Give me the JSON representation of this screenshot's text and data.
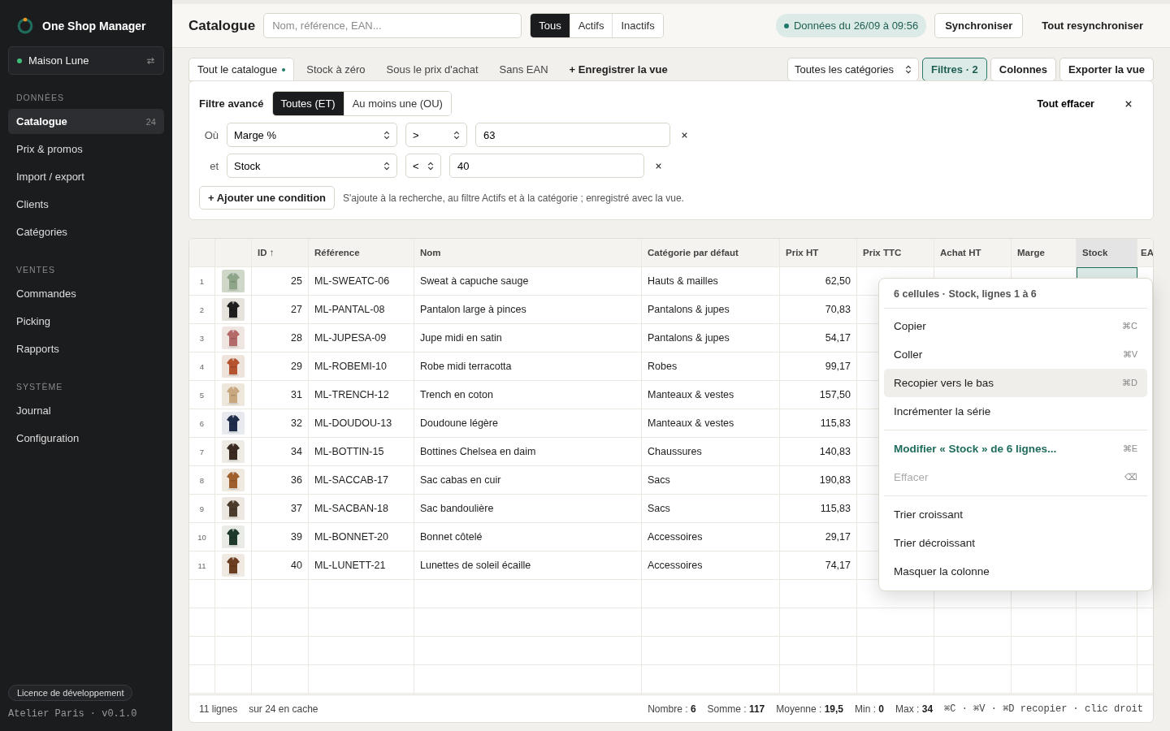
{
  "app": {
    "name": "One Shop Manager"
  },
  "store": {
    "name": "Maison Lune"
  },
  "sidebar": {
    "sections": [
      {
        "title": "DONNÉES",
        "items": [
          {
            "label": "Catalogue",
            "count": "24",
            "selected": true
          },
          {
            "label": "Prix & promos",
            "selected": false
          },
          {
            "label": "Import / export",
            "selected": false
          },
          {
            "label": "Clients",
            "selected": false
          },
          {
            "label": "Catégories",
            "selected": false
          }
        ]
      },
      {
        "title": "VENTES",
        "items": [
          {
            "label": "Commandes",
            "selected": false
          },
          {
            "label": "Picking",
            "selected": false
          },
          {
            "label": "Rapports",
            "selected": false
          }
        ]
      },
      {
        "title": "SYSTÈME",
        "items": [
          {
            "label": "Journal",
            "selected": false
          },
          {
            "label": "Configuration",
            "selected": false
          }
        ]
      }
    ],
    "license": "Licence de développement",
    "version": "Atelier Paris · v0.1.0"
  },
  "header": {
    "title": "Catalogue",
    "search": {
      "placeholder": "Nom, référence, EAN..."
    },
    "status_filter": [
      {
        "label": "Tous",
        "selected": true
      },
      {
        "label": "Actifs",
        "selected": false
      },
      {
        "label": "Inactifs",
        "selected": false
      }
    ],
    "sync_status": "Données du 26/09 à 09:56",
    "buttons": [
      {
        "label": "Synchroniser",
        "kind": "outline"
      },
      {
        "label": "Tout resynchroniser",
        "kind": "plain"
      }
    ]
  },
  "views": {
    "tabs": [
      {
        "label": "Tout le catalogue",
        "selected": true,
        "modified": true
      },
      {
        "label": "Stock à zéro",
        "selected": false,
        "modified": false
      },
      {
        "label": "Sous le prix d'achat",
        "selected": false,
        "modified": false
      },
      {
        "label": "Sans EAN",
        "selected": false,
        "modified": false
      }
    ],
    "save_view": "+ Enregistrer la vue",
    "category_select": "Toutes les catégories",
    "buttons": [
      {
        "label": "Filtres · 2",
        "active": true
      },
      {
        "label": "Colonnes",
        "active": false
      },
      {
        "label": "Exporter la vue",
        "active": false
      }
    ]
  },
  "filter": {
    "title": "Filtre avancé",
    "modes": [
      {
        "label": "Toutes (ET)",
        "selected": true
      },
      {
        "label": "Au moins une (OU)",
        "selected": false
      }
    ],
    "clear": "Tout effacer",
    "conditions": [
      {
        "connector": "Où",
        "field": "Marge %",
        "operator": ">",
        "value": "63"
      },
      {
        "connector": "et",
        "field": "Stock",
        "operator": "<",
        "value": "40"
      }
    ],
    "add": "+ Ajouter une condition",
    "hint": "S'ajoute à la recherche, au filtre Actifs et à la catégorie ; enregistré avec la vue."
  },
  "table": {
    "columns": [
      {
        "label": "ID ↑",
        "kind": "number",
        "selected": false
      },
      {
        "label": "Référence",
        "kind": "text",
        "selected": false
      },
      {
        "label": "Nom",
        "kind": "text",
        "selected": false
      },
      {
        "label": "Catégorie par défaut",
        "kind": "text",
        "selected": false
      },
      {
        "label": "Prix HT",
        "kind": "number",
        "selected": false
      },
      {
        "label": "Prix TTC",
        "kind": "number",
        "selected": false
      },
      {
        "label": "Achat HT",
        "kind": "number",
        "selected": false
      },
      {
        "label": "Marge",
        "kind": "number",
        "selected": false
      },
      {
        "label": "Stock",
        "kind": "number",
        "selected": true
      },
      {
        "label": "EA",
        "kind": "text",
        "selected": false
      }
    ],
    "rows": [
      {
        "num": "1",
        "stock_selected": true,
        "cells": [
          "25",
          "ML-SWEATC-06",
          "Sweat à capuche sauge",
          "Hauts & mailles",
          "62,50"
        ]
      },
      {
        "num": "2",
        "cells": [
          "27",
          "ML-PANTAL-08",
          "Pantalon large à pinces",
          "Pantalons & jupes",
          "70,83"
        ]
      },
      {
        "num": "3",
        "cells": [
          "28",
          "ML-JUPESA-09",
          "Jupe midi en satin",
          "Pantalons & jupes",
          "54,17"
        ]
      },
      {
        "num": "4",
        "cells": [
          "29",
          "ML-ROBEMI-10",
          "Robe midi terracotta",
          "Robes",
          "99,17"
        ]
      },
      {
        "num": "5",
        "cells": [
          "31",
          "ML-TRENCH-12",
          "Trench en coton",
          "Manteaux & vestes",
          "157,50"
        ]
      },
      {
        "num": "6",
        "cells": [
          "32",
          "ML-DOUDOU-13",
          "Doudoune légère",
          "Manteaux & vestes",
          "115,83"
        ]
      },
      {
        "num": "7",
        "cells": [
          "34",
          "ML-BOTTIN-15",
          "Bottines Chelsea en daim",
          "Chaussures",
          "140,83"
        ]
      },
      {
        "num": "8",
        "cells": [
          "36",
          "ML-SACCAB-17",
          "Sac cabas en cuir",
          "Sacs",
          "190,83"
        ]
      },
      {
        "num": "9",
        "cells": [
          "37",
          "ML-SACBAN-18",
          "Sac bandoulière",
          "Sacs",
          "115,83"
        ]
      },
      {
        "num": "10",
        "cells": [
          "39",
          "ML-BONNET-20",
          "Bonnet côtelé",
          "Accessoires",
          "29,17"
        ]
      },
      {
        "num": "11",
        "cells": [
          "40",
          "ML-LUNETT-21",
          "Lunettes de soleil écaille",
          "Accessoires",
          "74,17"
        ]
      }
    ]
  },
  "status_bar": {
    "rows": "11 lignes",
    "cache": "sur 24 en cache",
    "stats": [
      {
        "label": "Nombre :",
        "value": "6"
      },
      {
        "label": "Somme :",
        "value": "117"
      },
      {
        "label": "Moyenne :",
        "value": "19,5"
      },
      {
        "label": "Min :",
        "value": "0"
      },
      {
        "label": "Max :",
        "value": "34"
      }
    ],
    "shortcuts": "⌘C · ⌘V · ⌘D recopier · clic droit"
  },
  "context_menu": {
    "title": "6 cellules · Stock, lignes 1 à 6",
    "items": [
      {
        "kind": "action",
        "label": "Copier",
        "shortcut": "⌘C",
        "selected": false,
        "disabled": false
      },
      {
        "kind": "action",
        "label": "Coller",
        "shortcut": "⌘V",
        "selected": false,
        "disabled": false
      },
      {
        "kind": "action",
        "label": "Recopier vers le bas",
        "shortcut": "⌘D",
        "selected": true,
        "disabled": false
      },
      {
        "kind": "action",
        "label": "Incrémenter la série",
        "selected": false,
        "disabled": false
      },
      {
        "kind": "divider"
      },
      {
        "kind": "primary",
        "label": "Modifier « Stock » de 6 lignes...",
        "shortcut": "⌘E",
        "selected": false,
        "disabled": false
      },
      {
        "kind": "action",
        "label": "Effacer",
        "shortcut": "⌫",
        "selected": false,
        "disabled": true
      },
      {
        "kind": "divider"
      },
      {
        "kind": "action",
        "label": "Trier croissant",
        "selected": false,
        "disabled": false
      },
      {
        "kind": "action",
        "label": "Trier décroissant",
        "selected": false,
        "disabled": false
      },
      {
        "kind": "action",
        "label": "Masquer la colonne",
        "selected": false,
        "disabled": false
      }
    ]
  }
}
